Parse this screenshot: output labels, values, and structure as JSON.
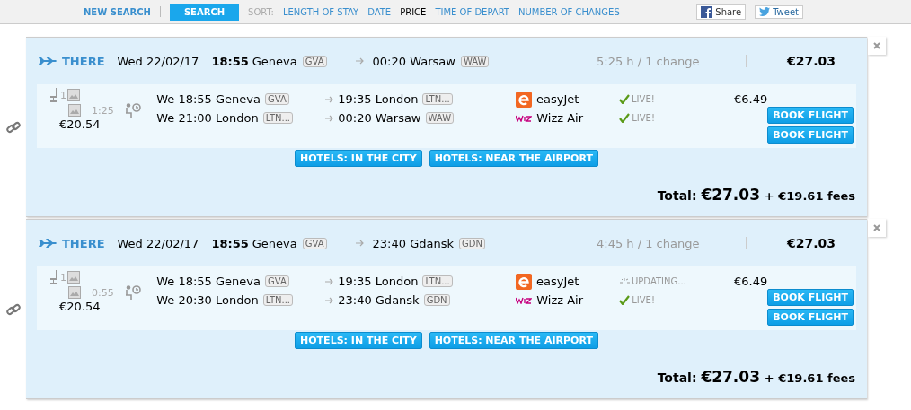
{
  "header": {
    "new_search": "NEW SEARCH",
    "search_button": "SEARCH",
    "sort_label": "SORT:",
    "sort_options": [
      {
        "label": "LENGTH OF STAY",
        "selected": false
      },
      {
        "label": "DATE",
        "selected": false
      },
      {
        "label": "PRICE",
        "selected": true
      },
      {
        "label": "TIME OF DEPART",
        "selected": false
      },
      {
        "label": "NUMBER OF CHANGES",
        "selected": false
      }
    ],
    "share": "Share",
    "tweet": "Tweet"
  },
  "results": [
    {
      "direction": "THERE",
      "date": "Wed 22/02/17",
      "dep_time": "18:55",
      "dep_city": "Geneva",
      "dep_code": "GVA",
      "arr_time": "00:20",
      "arr_city": "Warsaw",
      "arr_code": "WAW",
      "duration": "5:25 h / 1 change",
      "price": "€27.03",
      "stops": "1",
      "layover": "1:25",
      "base_price": "€20.54",
      "segments": [
        {
          "departure": "We 18:55 Geneva",
          "dep_code": "GVA",
          "arrival": "19:35 London",
          "arr_code": "LTN...",
          "airline": {
            "kind": "orange",
            "name": "easyJet"
          },
          "status": {
            "kind": "live",
            "text": "LIVE!"
          },
          "price": "€6.49"
        },
        {
          "departure": "We 21:00 London",
          "dep_code": "LTN...",
          "arrival": "00:20 Warsaw",
          "arr_code": "WAW",
          "airline": {
            "kind": "purple",
            "name": "Wizz Air"
          },
          "status": {
            "kind": "live",
            "text": "LIVE!"
          }
        }
      ],
      "book_buttons": [
        "BOOK FLIGHT",
        "BOOK FLIGHT"
      ],
      "hotels": [
        "HOTELS: IN THE CITY",
        "HOTELS: NEAR THE AIRPORT"
      ],
      "total_label": "Total:",
      "total": "€27.03",
      "fees": "+ €19.61 fees"
    },
    {
      "direction": "THERE",
      "date": "Wed 22/02/17",
      "dep_time": "18:55",
      "dep_city": "Geneva",
      "dep_code": "GVA",
      "arr_time": "23:40",
      "arr_city": "Gdansk",
      "arr_code": "GDN",
      "duration": "4:45 h / 1 change",
      "price": "€27.03",
      "stops": "1",
      "layover": "0:55",
      "base_price": "€20.54",
      "segments": [
        {
          "departure": "We 18:55 Geneva",
          "dep_code": "GVA",
          "arrival": "19:35 London",
          "arr_code": "LTN...",
          "airline": {
            "kind": "orange",
            "name": "easyJet"
          },
          "status": {
            "kind": "updating",
            "text": "UPDATING..."
          },
          "price": "€6.49"
        },
        {
          "departure": "We 20:30 London",
          "dep_code": "LTN...",
          "arrival": "23:40 Gdansk",
          "arr_code": "GDN",
          "airline": {
            "kind": "purple",
            "name": "Wizz Air"
          },
          "status": {
            "kind": "live",
            "text": "LIVE!"
          }
        }
      ],
      "book_buttons": [
        "BOOK FLIGHT",
        "BOOK FLIGHT"
      ],
      "hotels": [
        "HOTELS: IN THE CITY",
        "HOTELS: NEAR THE AIRPORT"
      ],
      "total_label": "Total:",
      "total": "€27.03",
      "fees": "+ €19.61 fees"
    }
  ]
}
